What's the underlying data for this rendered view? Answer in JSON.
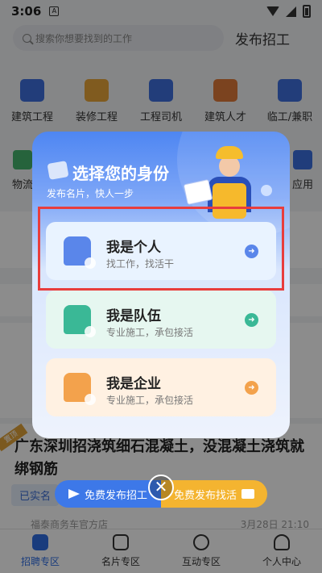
{
  "status_bar": {
    "time": "3:06",
    "app_badge": "A"
  },
  "search": {
    "placeholder": "搜索你想要找到的工作",
    "post_job": "发布招工"
  },
  "categories_row1": [
    "建筑工程",
    "装修工程",
    "工程司机",
    "建筑人才",
    "临工/兼职"
  ],
  "categories_row2_left": "物流",
  "categories_row2_right": "应用",
  "modal": {
    "title": "选择您的身份",
    "subtitle": "发布名片，快人一步",
    "options": [
      {
        "name": "我是个人",
        "desc": "找工作，找活干"
      },
      {
        "name": "我是队伍",
        "desc": "专业施工，承包接活"
      },
      {
        "name": "我是企业",
        "desc": "专业施工，承包接活"
      }
    ],
    "close_glyph": "✕"
  },
  "listing": {
    "hot_tag": "置顶",
    "title": "广东深圳招浇筑细石混凝土，没混凝土浇筑就绑钢筋",
    "verified": "已实名",
    "company": "福泰商务车官方店",
    "time": "3月28日 21:10"
  },
  "publish_bar": {
    "left": "免费发布招工",
    "right": "免费发布找活"
  },
  "tabs": [
    {
      "label": "招聘专区",
      "active": true
    },
    {
      "label": "名片专区",
      "active": false
    },
    {
      "label": "互动专区",
      "active": false
    },
    {
      "label": "个人中心",
      "active": false
    }
  ],
  "colors": {
    "primary": "#2f6de3",
    "highlight": "#e83d3d",
    "team": "#3ab896",
    "company": "#f3a24c"
  }
}
